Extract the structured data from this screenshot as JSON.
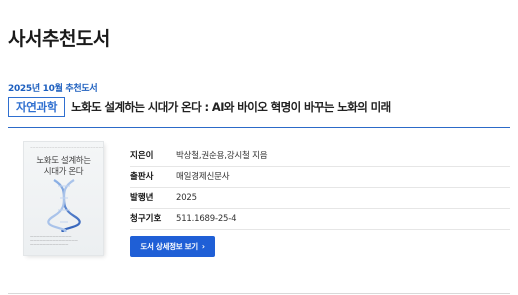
{
  "page": {
    "title": "사서추천도서"
  },
  "recommendation": {
    "month_label": "2025년 10월 추천도서",
    "category": "자연과학",
    "book_title": "노화도 설계하는 시대가 온다 : AI와 바이오 혁명이 바꾸는 노화의 미래"
  },
  "cover": {
    "title_line1": "노화도 설계하는",
    "title_line2": "시대가 온다"
  },
  "details": [
    {
      "key": "지은이",
      "value": "박상철,권순용,강시철 지음"
    },
    {
      "key": "출판사",
      "value": "매일경제신문사"
    },
    {
      "key": "발행년",
      "value": "2025"
    },
    {
      "key": "청구기호",
      "value": "511.1689-25-4"
    }
  ],
  "detail_button": {
    "label": "도서 상세정보 보기",
    "arrow": "›"
  }
}
